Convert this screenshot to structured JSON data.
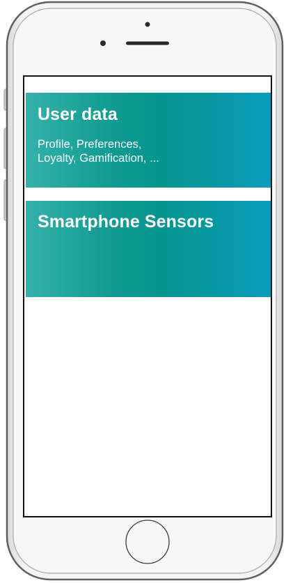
{
  "cards": [
    {
      "title": "User data",
      "subtitle_lines": [
        "Profile, Preferences,",
        "Loyalty, Gamification, ..."
      ]
    },
    {
      "title": "Smartphone Sensors"
    }
  ],
  "colors": {
    "card_gradient_start": "#34b1aa",
    "card_gradient_mid": "#06958f",
    "card_gradient_end": "#0a9cbb",
    "text": "#ffffff"
  }
}
